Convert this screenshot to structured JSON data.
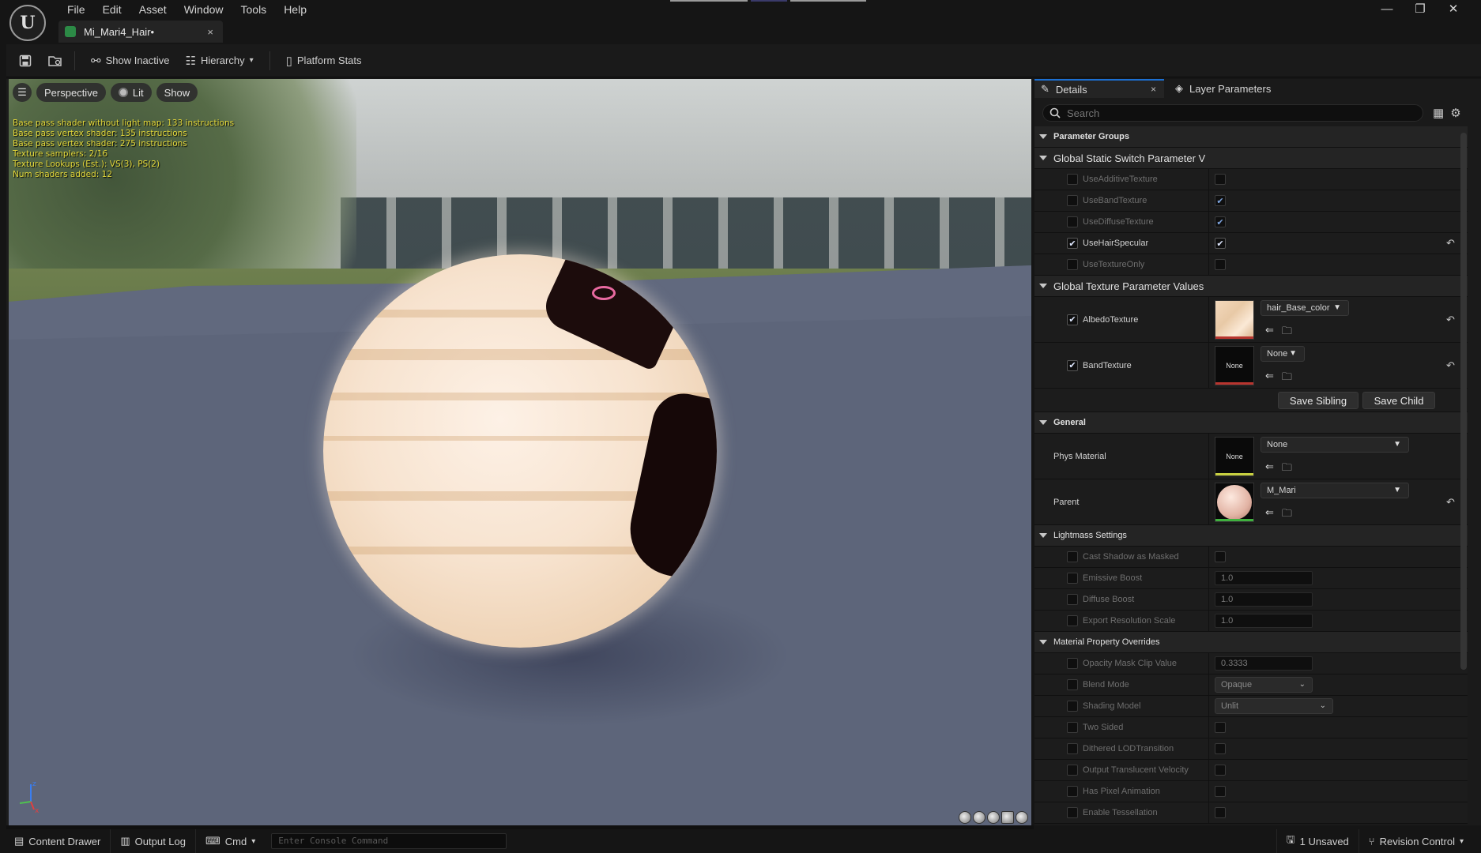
{
  "app": {
    "logo_text": "U",
    "document_tab": "Mi_Mari4_Hair•",
    "close_glyph": "×"
  },
  "menu": [
    "File",
    "Edit",
    "Asset",
    "Window",
    "Tools",
    "Help"
  ],
  "window_controls": {
    "minimize": "—",
    "restore": "❐",
    "close": "✕"
  },
  "toolbar": {
    "show_inactive": "Show Inactive",
    "hierarchy": "Hierarchy",
    "platform_stats": "Platform Stats"
  },
  "viewport": {
    "perspective": "Perspective",
    "lit": "Lit",
    "show": "Show",
    "stats": [
      "Base pass shader without light map: 133 instructions",
      "Base pass vertex shader: 135 instructions",
      "Base pass vertex shader: 275 instructions",
      "Texture samplers: 2/16",
      "Texture Lookups (Est.): VS(3), PS(2)",
      "Num shaders added: 12"
    ]
  },
  "details": {
    "tab_details": "Details",
    "tab_layer_params": "Layer Parameters",
    "search_placeholder": "Search",
    "parameter_groups": "Parameter Groups",
    "static_switch_header": "Global Static Switch Parameter V",
    "static_switches": [
      {
        "name": "UseAdditiveTexture",
        "override": false,
        "value": false
      },
      {
        "name": "UseBandTexture",
        "override": false,
        "value": true
      },
      {
        "name": "UseDiffuseTexture",
        "override": false,
        "value": true
      },
      {
        "name": "UseHairSpecular",
        "override": true,
        "value": true
      },
      {
        "name": "UseTextureOnly",
        "override": false,
        "value": false
      }
    ],
    "texture_header": "Global Texture Parameter Values",
    "albedo": {
      "name": "AlbedoTexture",
      "asset": "hair_Base_color"
    },
    "band": {
      "name": "BandTexture",
      "asset": "None",
      "thumb": "None"
    },
    "save_sibling": "Save Sibling",
    "save_child": "Save Child",
    "general_header": "General",
    "phys_material": {
      "name": "Phys Material",
      "asset": "None",
      "thumb": "None"
    },
    "parent": {
      "name": "Parent",
      "asset": "M_Mari"
    },
    "lightmass_header": "Lightmass Settings",
    "lightmass": {
      "cast_shadow": "Cast Shadow as Masked",
      "emissive_boost": "Emissive Boost",
      "emissive_value": "1.0",
      "diffuse_boost": "Diffuse Boost",
      "diffuse_value": "1.0",
      "export_scale": "Export Resolution Scale",
      "export_value": "1.0"
    },
    "overrides_header": "Material Property Overrides",
    "overrides": {
      "opacity_clip": "Opacity Mask Clip Value",
      "opacity_value": "0.3333",
      "blend_mode": "Blend Mode",
      "blend_value": "Opaque",
      "shading_model": "Shading Model",
      "shading_value": "Unlit",
      "two_sided": "Two Sided",
      "dithered": "Dithered LODTransition",
      "translucent_velocity": "Output Translucent Velocity",
      "pixel_animation": "Has Pixel Animation",
      "tessellation": "Enable Tessellation"
    }
  },
  "statusbar": {
    "content_drawer": "Content Drawer",
    "output_log": "Output Log",
    "cmd": "Cmd",
    "console_placeholder": "Enter Console Command",
    "unsaved": "1 Unsaved",
    "revision_control": "Revision Control"
  },
  "colors": {
    "accent": "#1c6fd1",
    "stats_text": "#e4d83a",
    "floor": "#5d657a"
  }
}
